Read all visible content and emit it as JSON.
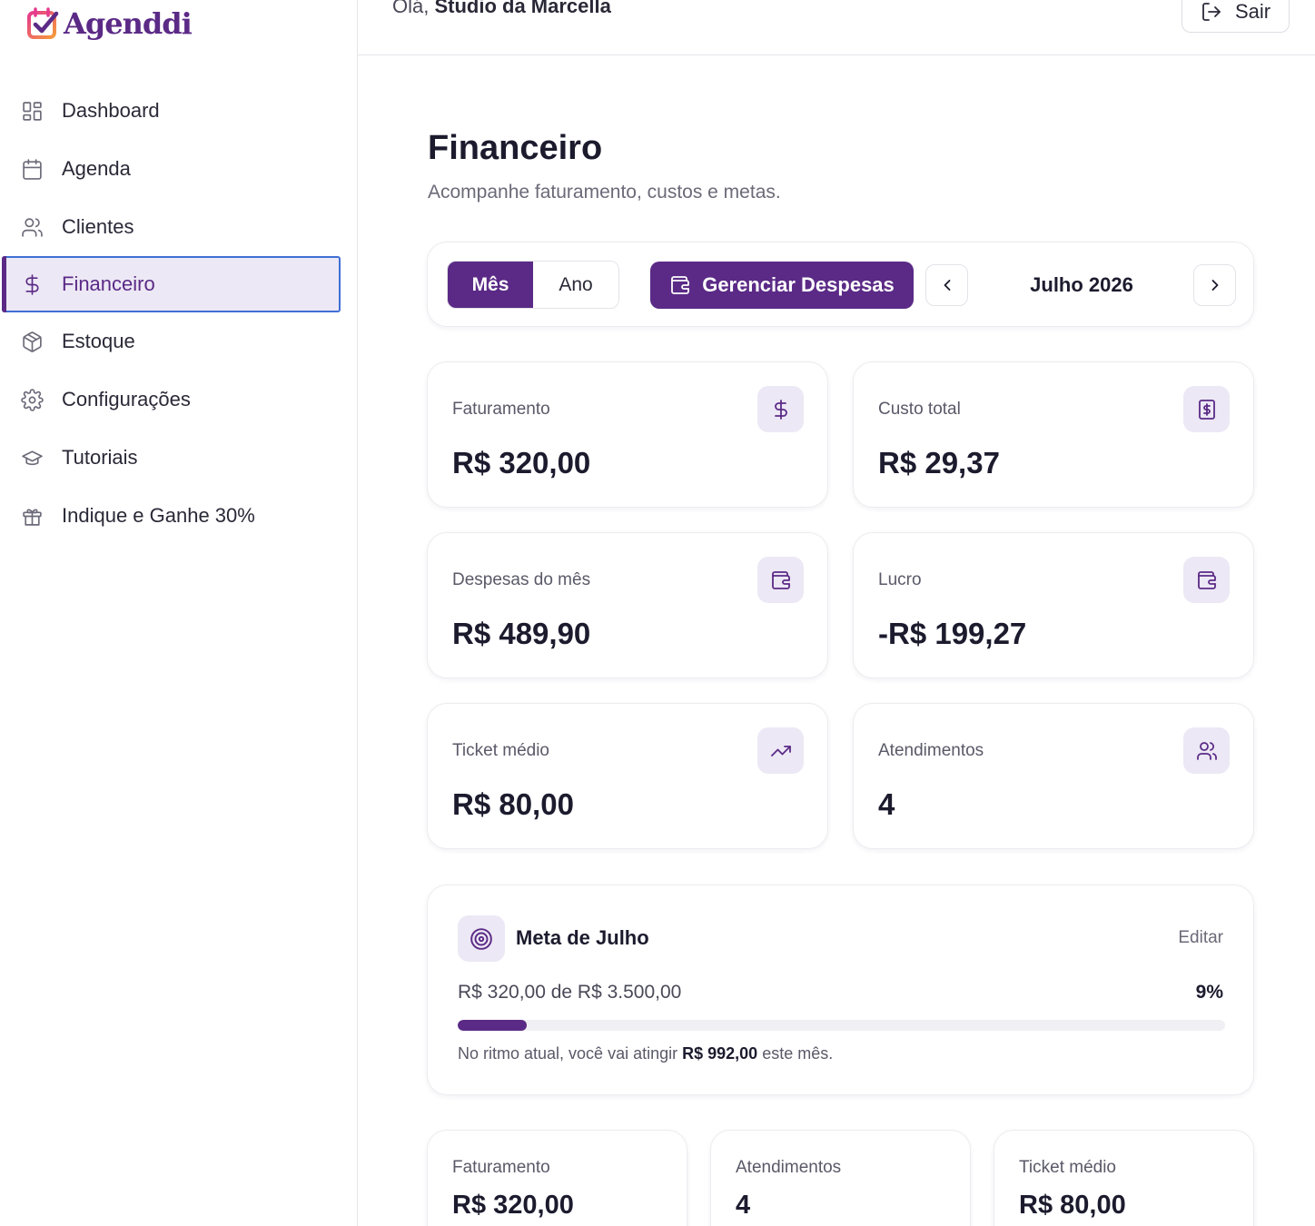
{
  "app": {
    "name": "Agenddi",
    "brand_color": "#5b2a86"
  },
  "sidebar": {
    "items": [
      {
        "label": "Dashboard",
        "icon": "dashboard-icon"
      },
      {
        "label": "Agenda",
        "icon": "calendar-icon"
      },
      {
        "label": "Clientes",
        "icon": "users-icon"
      },
      {
        "label": "Financeiro",
        "icon": "dollar-icon",
        "active": true
      },
      {
        "label": "Estoque",
        "icon": "box-icon"
      },
      {
        "label": "Configurações",
        "icon": "gear-icon"
      },
      {
        "label": "Tutoriais",
        "icon": "graduation-cap-icon"
      },
      {
        "label": "Indique e Ganhe 30%",
        "icon": "gift-icon"
      }
    ]
  },
  "header": {
    "greeting_prefix": "Olá,",
    "user_name": "Studio da Marcella",
    "logout_label": "Sair"
  },
  "page": {
    "title": "Financeiro",
    "subtitle": "Acompanhe faturamento, custos e metas."
  },
  "toolbar": {
    "period_options": [
      "Mês",
      "Ano"
    ],
    "selected_period": "Mês",
    "manage_expenses_label": "Gerenciar Despesas",
    "current_period": "Julho 2026"
  },
  "stats": [
    {
      "label": "Faturamento",
      "value": "R$ 320,00",
      "icon": "dollar-icon"
    },
    {
      "label": "Custo total",
      "value": "R$ 29,37",
      "icon": "receipt-icon"
    },
    {
      "label": "Despesas do mês",
      "value": "R$ 489,90",
      "icon": "wallet-icon"
    },
    {
      "label": "Lucro",
      "value": "-R$ 199,27",
      "icon": "wallet-icon"
    },
    {
      "label": "Ticket médio",
      "value": "R$ 80,00",
      "icon": "trending-up-icon"
    },
    {
      "label": "Atendimentos",
      "value": "4",
      "icon": "users-icon"
    }
  ],
  "goal": {
    "title": "Meta de Julho",
    "edit_label": "Editar",
    "progress_text": "R$ 320,00 de R$ 3.500,00",
    "percent_label": "9%",
    "progress_fraction": 0.09,
    "note_prefix": "No ritmo atual, você vai atingir",
    "note_value": "R$ 992,00",
    "note_suffix": "este mês."
  },
  "summary": [
    {
      "label": "Faturamento",
      "value": "R$ 320,00"
    },
    {
      "label": "Atendimentos",
      "value": "4"
    },
    {
      "label": "Ticket médio",
      "value": "R$ 80,00"
    }
  ]
}
